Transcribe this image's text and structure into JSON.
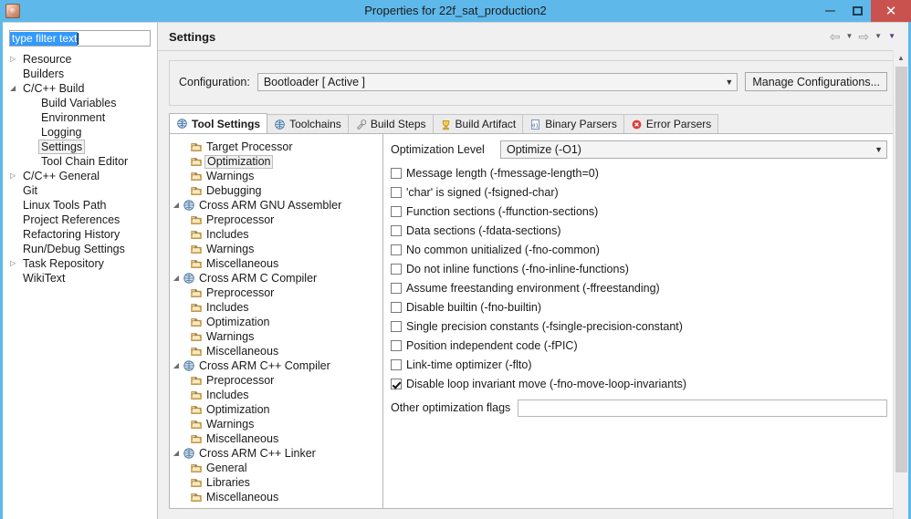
{
  "window": {
    "title": "Properties for 22f_sat_production2",
    "app_icon": "properties-app-icon",
    "minimize_label": "–",
    "maximize_label": "",
    "close_label": "✕"
  },
  "filter": {
    "value": "type filter text",
    "placeholder": "type filter text"
  },
  "nav": {
    "items": [
      {
        "label": "Resource",
        "state": "collapsed",
        "indent": 0,
        "selected": false
      },
      {
        "label": "Builders",
        "state": "none",
        "indent": 0,
        "selected": false
      },
      {
        "label": "C/C++ Build",
        "state": "expanded",
        "indent": 0,
        "selected": false
      },
      {
        "label": "Build Variables",
        "state": "none",
        "indent": 1,
        "selected": false
      },
      {
        "label": "Environment",
        "state": "none",
        "indent": 1,
        "selected": false
      },
      {
        "label": "Logging",
        "state": "none",
        "indent": 1,
        "selected": false
      },
      {
        "label": "Settings",
        "state": "none",
        "indent": 1,
        "selected": true
      },
      {
        "label": "Tool Chain Editor",
        "state": "none",
        "indent": 1,
        "selected": false
      },
      {
        "label": "C/C++ General",
        "state": "collapsed",
        "indent": 0,
        "selected": false
      },
      {
        "label": "Git",
        "state": "none",
        "indent": 0,
        "selected": false
      },
      {
        "label": "Linux Tools Path",
        "state": "none",
        "indent": 0,
        "selected": false
      },
      {
        "label": "Project References",
        "state": "none",
        "indent": 0,
        "selected": false
      },
      {
        "label": "Refactoring History",
        "state": "none",
        "indent": 0,
        "selected": false
      },
      {
        "label": "Run/Debug Settings",
        "state": "none",
        "indent": 0,
        "selected": false
      },
      {
        "label": "Task Repository",
        "state": "collapsed",
        "indent": 0,
        "selected": false
      },
      {
        "label": "WikiText",
        "state": "none",
        "indent": 0,
        "selected": false
      }
    ]
  },
  "header": {
    "title": "Settings",
    "back_icon": "back-arrow-icon",
    "back_menu_icon": "chevron-down-icon",
    "forward_icon": "forward-arrow-icon",
    "forward_menu_icon": "chevron-down-icon",
    "menu_icon": "chevron-down-icon"
  },
  "config": {
    "label": "Configuration:",
    "value": "Bootloader  [ Active ]",
    "dropdown_icon": "chevron-down-icon",
    "manage_button": "Manage Configurations..."
  },
  "tabs": [
    {
      "label": "Tool Settings",
      "icon": "tool-settings-icon",
      "active": true
    },
    {
      "label": "Toolchains",
      "icon": "toolchains-icon",
      "active": false
    },
    {
      "label": "Build Steps",
      "icon": "build-steps-icon",
      "active": false
    },
    {
      "label": "Build Artifact",
      "icon": "build-artifact-icon",
      "active": false
    },
    {
      "label": "Binary Parsers",
      "icon": "binary-parsers-icon",
      "active": false
    },
    {
      "label": "Error Parsers",
      "icon": "error-parsers-icon",
      "active": false
    }
  ],
  "tool_tree": [
    {
      "label": "Target Processor",
      "icon": "page-icon",
      "state": "none",
      "child": true,
      "selected": false
    },
    {
      "label": "Optimization",
      "icon": "page-icon",
      "state": "none",
      "child": true,
      "selected": true
    },
    {
      "label": "Warnings",
      "icon": "page-icon",
      "state": "none",
      "child": true,
      "selected": false
    },
    {
      "label": "Debugging",
      "icon": "page-icon",
      "state": "none",
      "child": true,
      "selected": false
    },
    {
      "label": "Cross ARM GNU Assembler",
      "icon": "tool-icon",
      "state": "expanded",
      "child": false,
      "selected": false
    },
    {
      "label": "Preprocessor",
      "icon": "page-icon",
      "state": "none",
      "child": true,
      "selected": false
    },
    {
      "label": "Includes",
      "icon": "page-icon",
      "state": "none",
      "child": true,
      "selected": false
    },
    {
      "label": "Warnings",
      "icon": "page-icon",
      "state": "none",
      "child": true,
      "selected": false
    },
    {
      "label": "Miscellaneous",
      "icon": "page-icon",
      "state": "none",
      "child": true,
      "selected": false
    },
    {
      "label": "Cross ARM C Compiler",
      "icon": "tool-icon",
      "state": "expanded",
      "child": false,
      "selected": false
    },
    {
      "label": "Preprocessor",
      "icon": "page-icon",
      "state": "none",
      "child": true,
      "selected": false
    },
    {
      "label": "Includes",
      "icon": "page-icon",
      "state": "none",
      "child": true,
      "selected": false
    },
    {
      "label": "Optimization",
      "icon": "page-icon",
      "state": "none",
      "child": true,
      "selected": false
    },
    {
      "label": "Warnings",
      "icon": "page-icon",
      "state": "none",
      "child": true,
      "selected": false
    },
    {
      "label": "Miscellaneous",
      "icon": "page-icon",
      "state": "none",
      "child": true,
      "selected": false
    },
    {
      "label": "Cross ARM C++ Compiler",
      "icon": "tool-icon",
      "state": "expanded",
      "child": false,
      "selected": false
    },
    {
      "label": "Preprocessor",
      "icon": "page-icon",
      "state": "none",
      "child": true,
      "selected": false
    },
    {
      "label": "Includes",
      "icon": "page-icon",
      "state": "none",
      "child": true,
      "selected": false
    },
    {
      "label": "Optimization",
      "icon": "page-icon",
      "state": "none",
      "child": true,
      "selected": false
    },
    {
      "label": "Warnings",
      "icon": "page-icon",
      "state": "none",
      "child": true,
      "selected": false
    },
    {
      "label": "Miscellaneous",
      "icon": "page-icon",
      "state": "none",
      "child": true,
      "selected": false
    },
    {
      "label": "Cross ARM C++ Linker",
      "icon": "tool-icon",
      "state": "expanded",
      "child": false,
      "selected": false
    },
    {
      "label": "General",
      "icon": "page-icon",
      "state": "none",
      "child": true,
      "selected": false
    },
    {
      "label": "Libraries",
      "icon": "page-icon",
      "state": "none",
      "child": true,
      "selected": false
    },
    {
      "label": "Miscellaneous",
      "icon": "page-icon",
      "state": "none",
      "child": true,
      "selected": false
    }
  ],
  "options": {
    "level_label": "Optimization Level",
    "level_value": "Optimize (-O1)",
    "level_dropdown_icon": "chevron-down-icon",
    "checkboxes": [
      {
        "label": "Message length (-fmessage-length=0)",
        "checked": false
      },
      {
        "label": "'char' is signed (-fsigned-char)",
        "checked": false
      },
      {
        "label": "Function sections (-ffunction-sections)",
        "checked": false
      },
      {
        "label": "Data sections (-fdata-sections)",
        "checked": false
      },
      {
        "label": "No common unitialized (-fno-common)",
        "checked": false
      },
      {
        "label": "Do not inline functions (-fno-inline-functions)",
        "checked": false
      },
      {
        "label": "Assume freestanding environment (-ffreestanding)",
        "checked": false
      },
      {
        "label": "Disable builtin (-fno-builtin)",
        "checked": false
      },
      {
        "label": "Single precision constants (-fsingle-precision-constant)",
        "checked": false
      },
      {
        "label": "Position independent code (-fPIC)",
        "checked": false
      },
      {
        "label": "Link-time optimizer (-flto)",
        "checked": false
      },
      {
        "label": "Disable loop invariant move (-fno-move-loop-invariants)",
        "checked": true
      }
    ],
    "other_flags_label": "Other optimization flags",
    "other_flags_value": "",
    "other_flags_placeholder": ""
  },
  "scrollbar": {
    "up_icon": "scroll-up-icon"
  },
  "colors": {
    "titlebar": "#5eb8ea",
    "close": "#c9524f",
    "selection": "#3399ff",
    "panel": "#f0f0f0"
  }
}
